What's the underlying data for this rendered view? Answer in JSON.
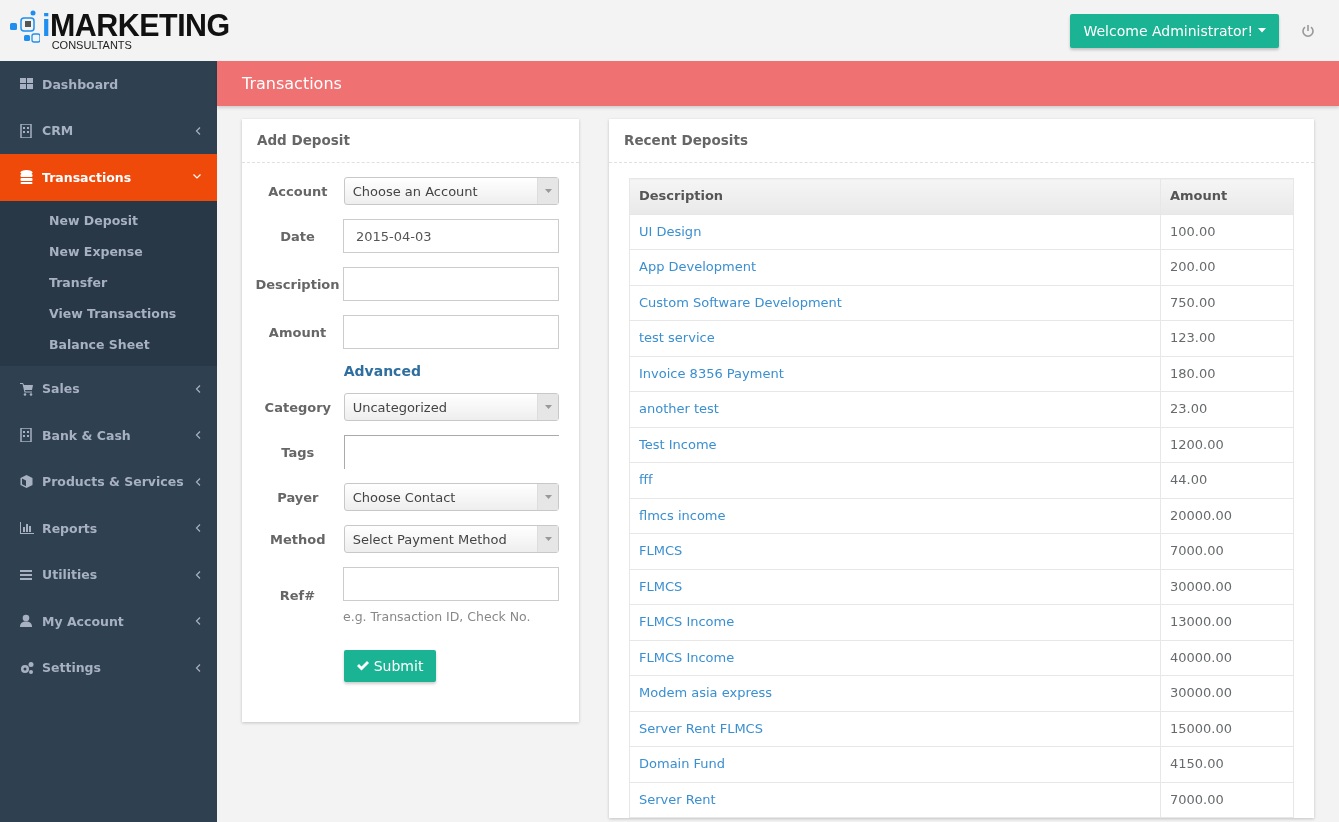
{
  "header": {
    "logo": {
      "accent": "i",
      "main": "MARKETING",
      "sub": "CONSULTANTS"
    },
    "user_button": "Welcome Administrator!"
  },
  "sidebar": {
    "items": [
      {
        "label": "Dashboard",
        "selected": false
      },
      {
        "label": "CRM",
        "selected": false,
        "expanded": false
      },
      {
        "label": "Transactions",
        "selected": true,
        "expanded": true,
        "children": [
          {
            "label": "New Deposit"
          },
          {
            "label": "New Expense"
          },
          {
            "label": "Transfer"
          },
          {
            "label": "View Transactions"
          },
          {
            "label": "Balance Sheet"
          }
        ]
      },
      {
        "label": "Sales",
        "selected": false,
        "expanded": false
      },
      {
        "label": "Bank & Cash",
        "selected": false,
        "expanded": false
      },
      {
        "label": "Products & Services",
        "selected": false,
        "expanded": false
      },
      {
        "label": "Reports",
        "selected": false,
        "expanded": false
      },
      {
        "label": "Utilities",
        "selected": false,
        "expanded": false
      },
      {
        "label": "My Account",
        "selected": false,
        "expanded": false
      },
      {
        "label": "Settings",
        "selected": false,
        "expanded": false
      }
    ]
  },
  "page_title": "Transactions",
  "add_deposit": {
    "title": "Add Deposit",
    "rows": [
      {
        "kind": "select",
        "label": "Account",
        "value": "Choose an Account"
      },
      {
        "kind": "input",
        "label": "Date",
        "value": "2015-04-03"
      },
      {
        "kind": "input",
        "label": "Description"
      },
      {
        "kind": "input",
        "label": "Amount"
      },
      {
        "kind": "link",
        "value": "Advanced"
      },
      {
        "kind": "select",
        "label": "Category",
        "value": "Uncategorized"
      },
      {
        "kind": "tags",
        "label": "Tags"
      },
      {
        "kind": "select",
        "label": "Payer",
        "value": "Choose Contact"
      },
      {
        "kind": "select",
        "label": "Method",
        "value": "Select Payment Method"
      },
      {
        "kind": "input",
        "label": "Ref#",
        "help": "e.g. Transaction ID, Check No."
      }
    ],
    "submit": "Submit"
  },
  "recent_deposits": {
    "title": "Recent Deposits",
    "columns": [
      "Description",
      "Amount"
    ],
    "rows": [
      [
        "UI Design",
        "100.00"
      ],
      [
        "App Development",
        "200.00"
      ],
      [
        "Custom Software Development",
        "750.00"
      ],
      [
        "test service",
        "123.00"
      ],
      [
        "Invoice 8356 Payment",
        "180.00"
      ],
      [
        "another test",
        "23.00"
      ],
      [
        "Test Income",
        "1200.00"
      ],
      [
        "fff",
        "44.00"
      ],
      [
        "flmcs income",
        "20000.00"
      ],
      [
        "FLMCS",
        "7000.00"
      ],
      [
        "FLMCS",
        "30000.00"
      ],
      [
        "FLMCS Income",
        "13000.00"
      ],
      [
        "FLMCS Income",
        "40000.00"
      ],
      [
        "Modem asia express",
        "30000.00"
      ],
      [
        "Server Rent FLMCS",
        "15000.00"
      ],
      [
        "Domain Fund",
        "4150.00"
      ],
      [
        "Server Rent",
        "7000.00"
      ]
    ]
  }
}
